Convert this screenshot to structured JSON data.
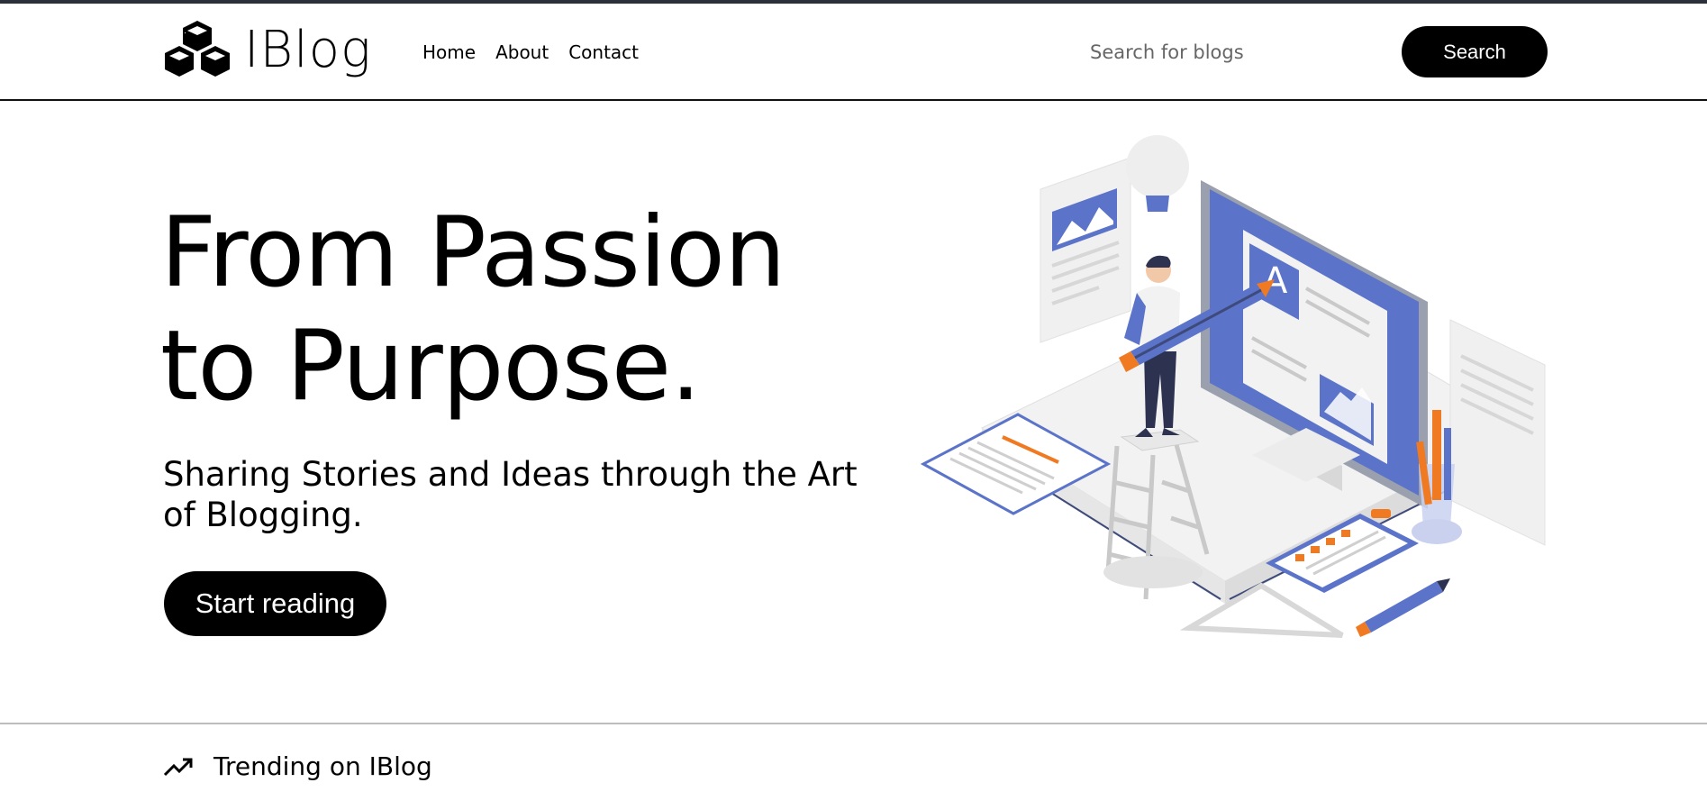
{
  "brand": {
    "name": "IBlog",
    "logo_icon": "cubes-icon"
  },
  "nav": {
    "items": [
      {
        "label": "Home"
      },
      {
        "label": "About"
      },
      {
        "label": "Contact"
      }
    ]
  },
  "search": {
    "placeholder": "Search for blogs",
    "value": "",
    "button_label": "Search"
  },
  "hero": {
    "title_line1": "From Passion",
    "title_line2": "to Purpose.",
    "subtitle": "Sharing Stories and Ideas through the Art of Blogging.",
    "cta_label": "Start reading",
    "illustration": "blogger-at-monitor-illustration"
  },
  "trending": {
    "icon": "trending-up-icon",
    "label": "Trending on IBlog"
  },
  "colors": {
    "accent_blue": "#5b74c9",
    "accent_orange": "#f07a22",
    "button_bg": "#000000",
    "header_strip": "#2b303b"
  }
}
